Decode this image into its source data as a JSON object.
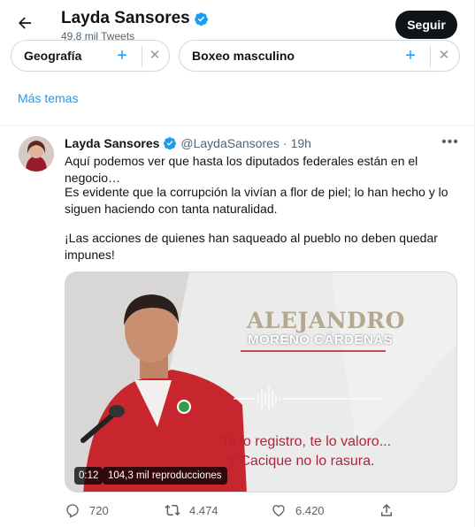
{
  "header": {
    "name": "Layda Sansores",
    "tweet_count": "49,8 mil Tweets",
    "follow_label": "Seguir"
  },
  "topics": [
    {
      "label": "Geografía"
    },
    {
      "label": "Boxeo masculino"
    }
  ],
  "more_topics": "Más temas",
  "tweet": {
    "name": "Layda Sansores",
    "handle": "@LaydaSansores",
    "separator": "·",
    "time": "19h",
    "paragraphs": [
      "Aquí podemos ver que hasta los diputados federales están en el negocio…",
      "Es evidente que la corrupción la vivían a flor de piel; lo han hecho y lo siguen haciendo con tanta naturalidad.",
      "¡Las acciones de quienes han saqueado al pueblo no deben quedar impunes!"
    ],
    "media": {
      "name_line1": "ALEJANDRO",
      "name_line2": "MORENO CÁRDENAS",
      "caption_line1": "Te lo registro, te lo valoro...",
      "caption_line2": "Y Cacique no lo rasura.",
      "duration": "0:12",
      "views": "104,3 mil reproducciones"
    },
    "actions": {
      "replies": "720",
      "retweets": "4.474",
      "likes": "6.420"
    }
  },
  "colors": {
    "accent": "#1d9bf0",
    "text": "#0f1419",
    "muted": "#536471",
    "caption": "#b3213e"
  }
}
